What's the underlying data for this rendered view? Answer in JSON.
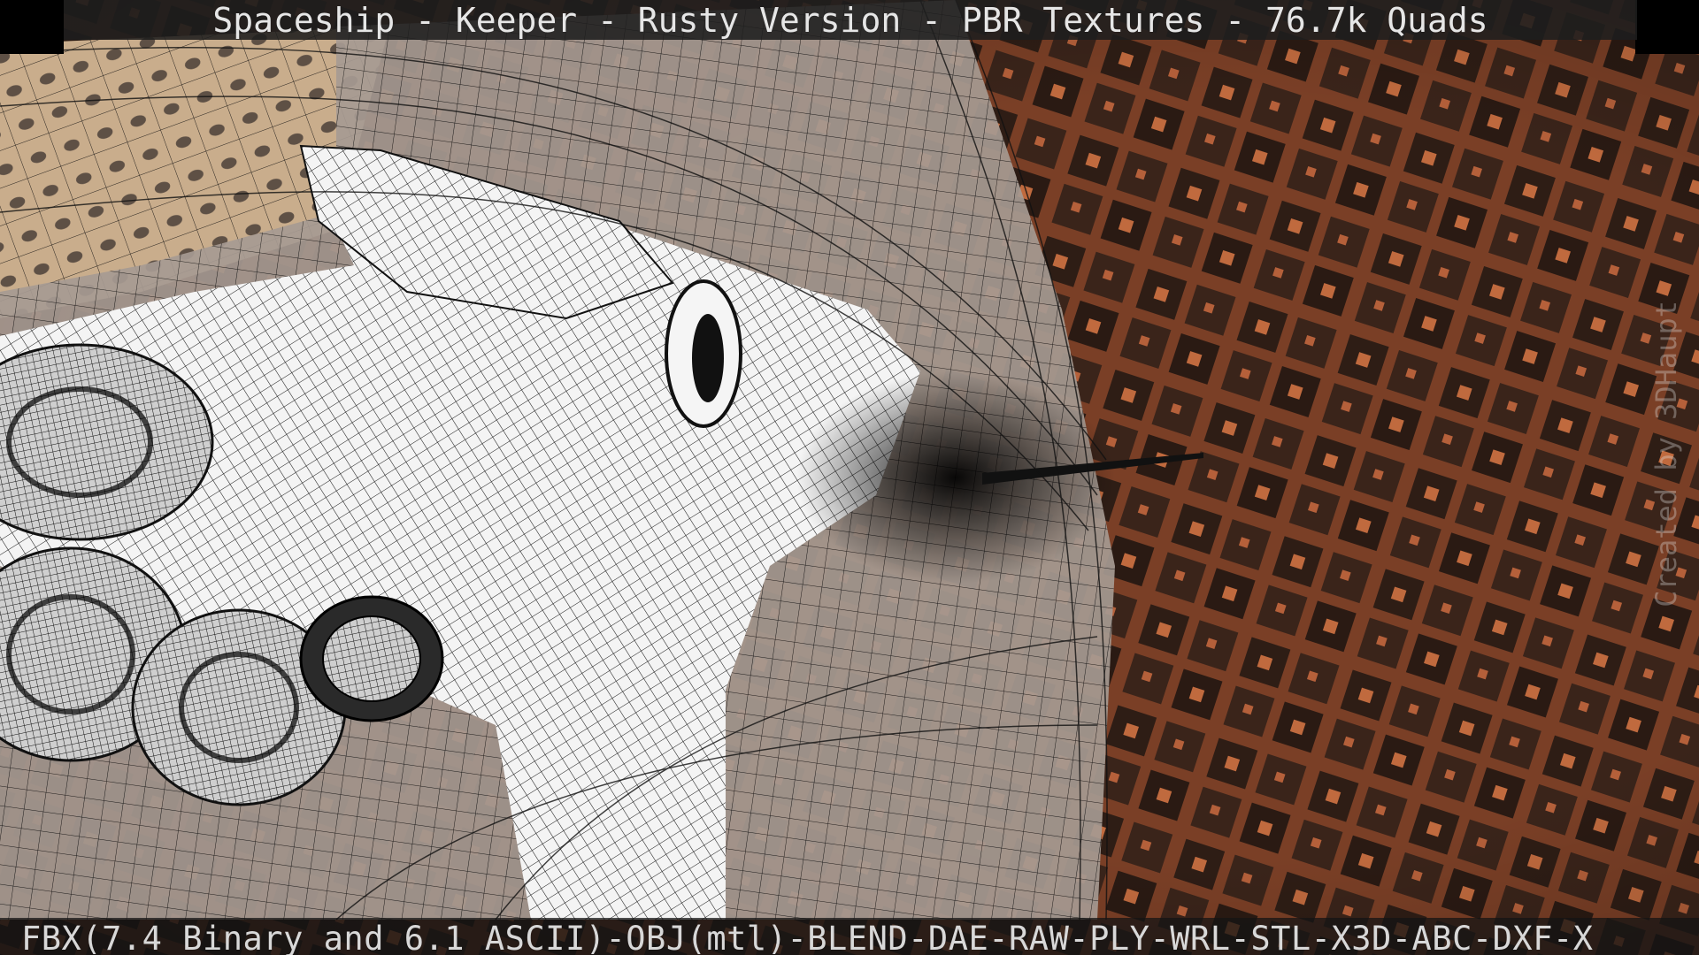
{
  "viewer": {
    "title": "Spaceship - Keeper - Rusty Version - PBR Textures - 76.7k Quads",
    "formats": "FBX(7.4 Binary and 6.1 ASCII)-OBJ(mtl)-BLEND-DAE-RAW-PLY-WRL-STL-X3D-ABC-DXF-X",
    "watermark": "Created by 3DHaupt"
  },
  "colors": {
    "fractal_orange": "#b8643a",
    "fractal_dark": "#4a2a1c",
    "hull_light": "#f2f2f2",
    "wire": "#111111"
  }
}
